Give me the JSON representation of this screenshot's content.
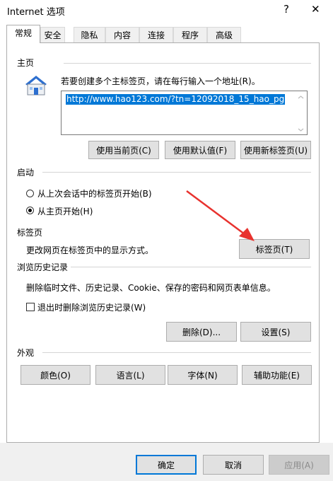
{
  "window": {
    "title": "Internet 选项",
    "help_glyph": "?",
    "close_glyph": "✕"
  },
  "tabs": [
    {
      "label": "常规"
    },
    {
      "label": "安全"
    },
    {
      "label": "隐私"
    },
    {
      "label": "内容"
    },
    {
      "label": "连接"
    },
    {
      "label": "程序"
    },
    {
      "label": "高级"
    }
  ],
  "home": {
    "heading": "主页",
    "instruction": "若要创建多个主标签页，请在每行输入一个地址(R)。",
    "url": "http://www.hao123.com/?tn=12092018_15_hao_pg",
    "btn_current": "使用当前页(C)",
    "btn_default": "使用默认值(F)",
    "btn_newtab": "使用新标签页(U)"
  },
  "startup": {
    "heading": "启动",
    "option_last": "从上次会话中的标签页开始(B)",
    "option_home": "从主页开始(H)",
    "selected": "home"
  },
  "tabsec": {
    "heading": "标签页",
    "desc": "更改网页在标签页中的显示方式。",
    "btn": "标签页(T)"
  },
  "history": {
    "heading": "浏览历史记录",
    "desc": "删除临时文件、历史记录、Cookie、保存的密码和网页表单信息。",
    "checkbox_label": "退出时删除浏览历史记录(W)",
    "checked": false,
    "btn_delete": "删除(D)...",
    "btn_settings": "设置(S)"
  },
  "appearance": {
    "heading": "外观",
    "btn_colors": "颜色(O)",
    "btn_languages": "语言(L)",
    "btn_fonts": "字体(N)",
    "btn_accessibility": "辅助功能(E)"
  },
  "footer": {
    "ok": "确定",
    "cancel": "取消",
    "apply": "应用(A)"
  },
  "colors": {
    "arrow": "#e8322e",
    "selection": "#0078d7"
  }
}
